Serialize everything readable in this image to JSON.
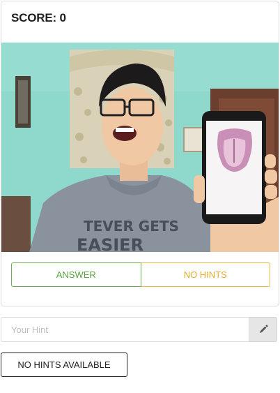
{
  "game": {
    "score_label": "SCORE: 0"
  },
  "actions": {
    "answer_label": "ANSWER",
    "hints_label": "NO HINTS"
  },
  "hint": {
    "placeholder": "Your Hint",
    "value": "",
    "edit_icon": "pencil-icon"
  },
  "no_hints_button": {
    "label": "NO HINTS AVAILABLE"
  },
  "colors": {
    "answer": "#5aa342",
    "hints": "#e0ad2c",
    "wall": "#8fd8cc"
  }
}
